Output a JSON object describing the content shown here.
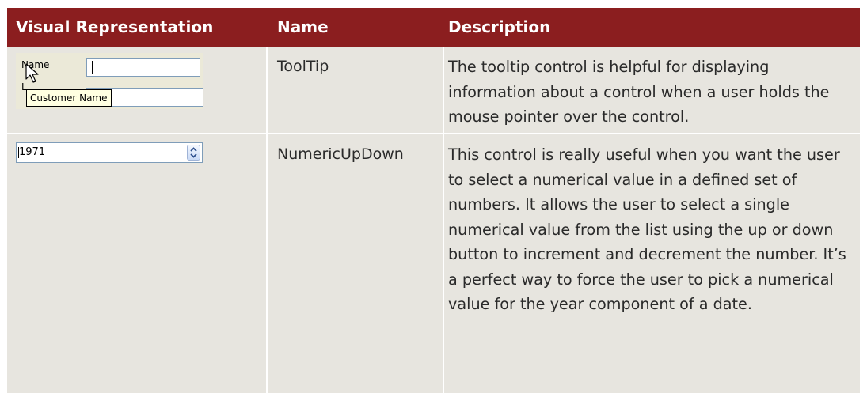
{
  "columns": {
    "visual": "Visual Representation",
    "name": "Name",
    "description": "Description"
  },
  "rows": [
    {
      "name": "ToolTip",
      "description": "The tooltip control is helpful for displaying information about a control when a user holds the mouse pointer over the control.",
      "visual": {
        "field_label": "Name",
        "field_label_2": "L",
        "tooltip_text": "Customer Name",
        "icons": [
          "mouse-pointer-icon"
        ]
      }
    },
    {
      "name": "NumericUpDown",
      "description": "This control is really useful when you want the user to select a numerical value in a defined set of numbers. It allows the user to select a single numerical value from the list using the up or down button to increment and decrement the number. It’s a perfect way to force the user to pick a numerical value for the year component of a date.",
      "visual": {
        "value": "1971",
        "icons": [
          "spin-up-icon",
          "spin-down-icon"
        ]
      }
    }
  ],
  "colors": {
    "header_bg": "#8b1e1f",
    "header_text": "#ffffff",
    "row_bg": "#e7e5df",
    "body_text": "#2a2a2a"
  }
}
